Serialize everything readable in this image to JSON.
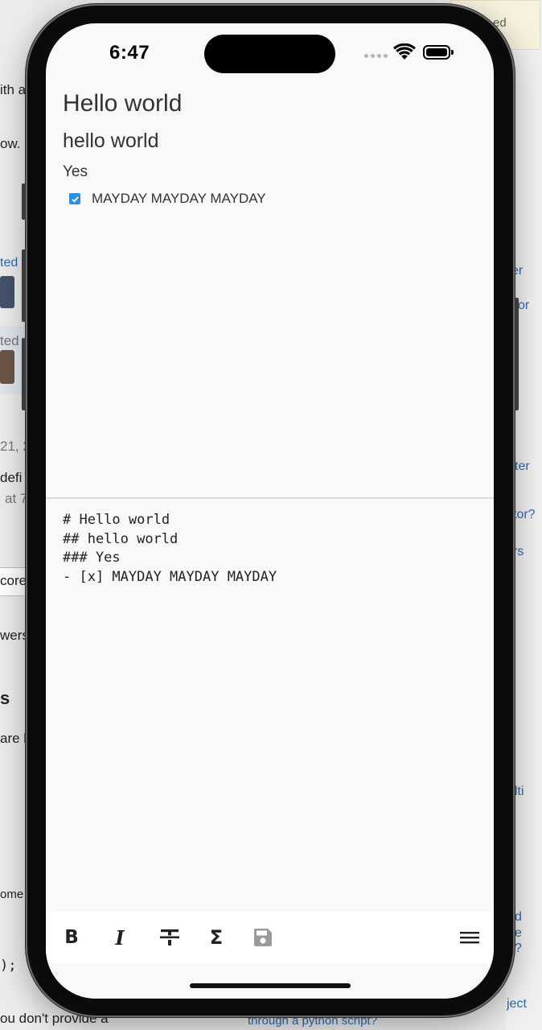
{
  "background_page": {
    "left_fragments": [
      "ith a",
      "ow.",
      "ted",
      "ted",
      "21, 2",
      "defi",
      "at 7",
      "core",
      "wers",
      "s",
      "are l",
      "ome",
      ");",
      "ou don't provide a"
    ],
    "right_fragments": [
      "ed",
      "er",
      "or",
      "ter",
      "tor?",
      "rs",
      "lti",
      "d",
      "e",
      "?",
      "ject",
      "through a python script?"
    ]
  },
  "status_bar": {
    "time": "6:47"
  },
  "preview": {
    "h1": "Hello world",
    "h2": "hello world",
    "h3": "Yes",
    "task": {
      "checked": true,
      "text": "MAYDAY MAYDAY MAYDAY"
    }
  },
  "editor": {
    "source": "# Hello world\n## hello world\n### Yes\n- [x] MAYDAY MAYDAY MAYDAY"
  },
  "toolbar": {
    "bold_label": "B",
    "italic_label": "I",
    "sigma_label": "Σ",
    "icons": [
      "bold-icon",
      "italic-icon",
      "strikethrough-icon",
      "sigma-icon",
      "save-icon",
      "menu-icon"
    ]
  },
  "colors": {
    "accent": "#2b8fe4",
    "screen_bg": "#f9f9f9",
    "text": "#333333"
  }
}
